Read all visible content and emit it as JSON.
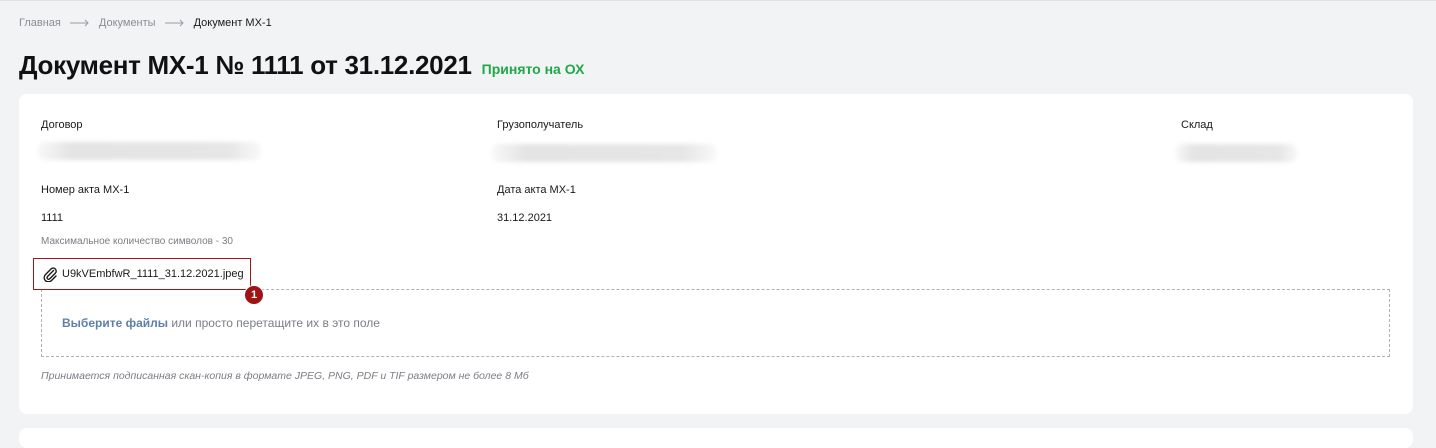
{
  "breadcrumb": {
    "items": [
      "Главная",
      "Документы"
    ],
    "current": "Документ МХ-1"
  },
  "page": {
    "title": "Документ МХ-1 № 1111 от 31.12.2021",
    "status": "Принято на ОХ"
  },
  "fields": {
    "contract_label": "Договор",
    "consignee_label": "Грузополучатель",
    "warehouse_label": "Склад",
    "act_number_label": "Номер акта МХ-1",
    "act_number_value": "1111",
    "act_number_hint": "Максимальное количество символов - 30",
    "act_date_label": "Дата акта МХ-1",
    "act_date_value": "31.12.2021"
  },
  "attachment": {
    "file_name": "U9kVEmbfwR_1111_31.12.2021.jpeg",
    "marker": "1",
    "icon": "paperclip-icon"
  },
  "upload": {
    "link_text": "Выберите файлы",
    "rest_text": " или просто перетащите их в это поле",
    "note": "Принимается подписанная скан-копия в формате JPEG, PNG, PDF и TIF размером не более 8 Мб"
  },
  "colors": {
    "status": "#1fa84a",
    "link": "#5f7fa8",
    "highlight": "#a01515",
    "background": "#f2f3f5"
  }
}
